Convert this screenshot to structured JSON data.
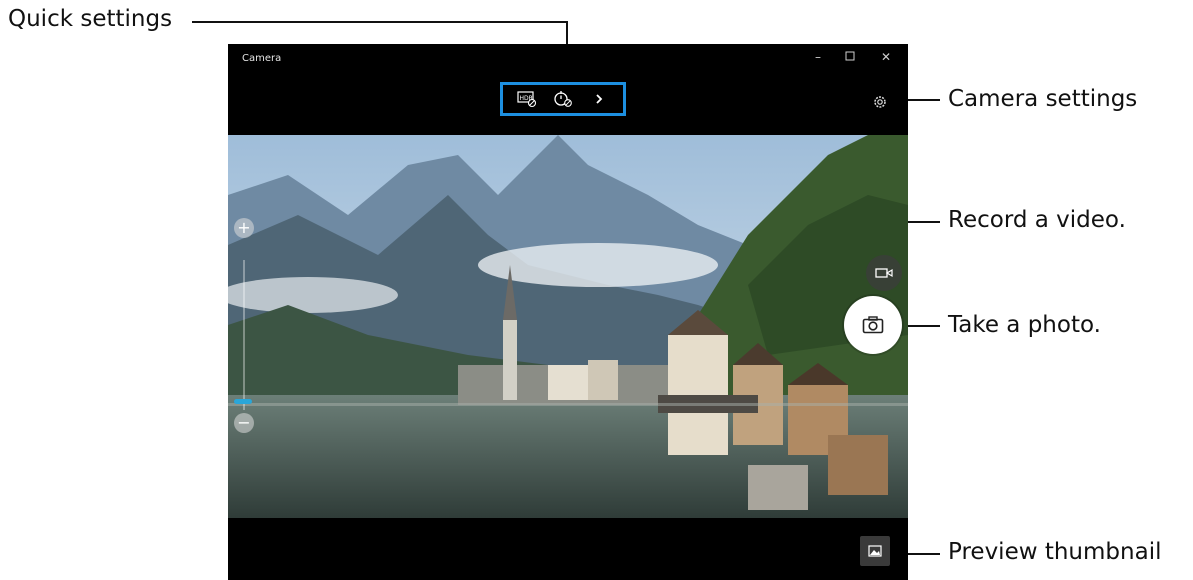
{
  "window": {
    "title": "Camera",
    "controls": [
      "minimize-icon",
      "maximize-icon",
      "close-icon"
    ]
  },
  "quick_settings": {
    "icons": [
      "hdr-icon",
      "timer-icon",
      "chevron-right-icon"
    ],
    "accent_color": "#1d8fe0"
  },
  "callouts": {
    "quick_settings": "Quick settings",
    "camera_settings": "Camera settings",
    "record_video": "Record a video.",
    "take_photo": "Take a photo.",
    "preview_thumbnail": "Preview thumbnail"
  },
  "zoom": {
    "in_icon": "plus-icon",
    "out_icon": "minus-icon",
    "accent_color": "#2aa6d8"
  },
  "icons": {
    "camera_settings": "gear-icon",
    "record_video": "video-camera-icon",
    "take_photo": "camera-icon",
    "preview_thumbnail": "image-icon"
  }
}
